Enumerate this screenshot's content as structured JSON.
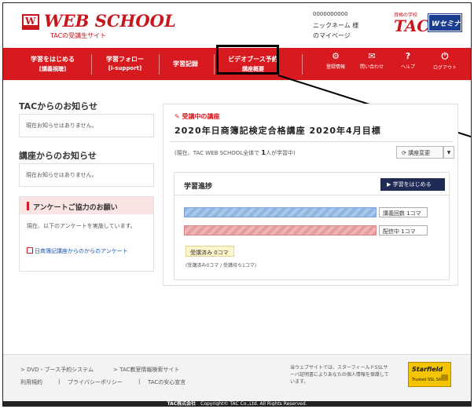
{
  "header": {
    "logo": "WEB SCHOOL",
    "logo_sub": "TACの受講生サイト",
    "user_id": "0000000000",
    "user_name": "ニックネーム 様",
    "my_page": "のマイページ",
    "brand_small": "資格の学校",
    "brand": "TAC",
    "partner": "Wセミナー"
  },
  "nav": {
    "items": [
      {
        "line1": "学習をはじめる",
        "line2": "[講義視聴]"
      },
      {
        "line1": "学習フォロー",
        "line2": "[i-support]"
      },
      {
        "line1": "学習記録",
        "line2": ""
      },
      {
        "line1": "ビデオブース予約",
        "line2": "講座概要"
      }
    ],
    "icons": [
      {
        "glyph": "⚙",
        "label": "登録情報"
      },
      {
        "glyph": "✉",
        "label": "問い合わせ"
      },
      {
        "glyph": "?",
        "label": "ヘルプ"
      },
      {
        "glyph": "⏻",
        "label": "ログアウト"
      }
    ]
  },
  "left": {
    "tac_notice_title": "TACからのお知らせ",
    "tac_notice_text": "現在お知らせはありません。",
    "course_notice_title": "講座からのお知らせ",
    "course_notice_text": "現在お知らせはありません。",
    "survey_title": "アンケートご協力のお願い",
    "survey_text": "現在、以下のアンケートを実施しています。",
    "survey_link": "日商簿記講座からのからのアンケート"
  },
  "course": {
    "label": "受講中の講座",
    "title": "2020年日商簿記検定合格講座 2020年4月目標",
    "note_prefix": "(現在、TAC WEB SCHOOL全体で",
    "note_count": "1",
    "note_suffix": "人が学習中)",
    "change_button": "講座変更",
    "progress_title": "学習進捗",
    "start_button": "▶ 学習をはじめる",
    "bar1_label": "講義回数 1コマ",
    "bar2_label": "配信中 1コマ",
    "done_label": "受講済み 0コマ",
    "done_sub": "(受講済み0コマ / 受講待ち1コマ)"
  },
  "progress": {
    "lecture_count": 1,
    "distributing": 1,
    "done": 0
  },
  "footer": {
    "link1": "> DVD・ブース予約システム",
    "link2": "> TAC教室情報検索サイト",
    "links2": [
      "利用規約",
      "プライバシーポリシー",
      "TACの安心宣言"
    ],
    "ssl_text": "当ウェブサイトでは、スターフィールドSSLサーバ証明書によりあなたの個人情報を保護しています。",
    "ssl_brand": "Starfield",
    "ssl_sub": "Trusted SSL Site",
    "company": "TAC株式会社",
    "copyright": "Copyright© TAC Co.,Ltd. All Rights Reserved."
  },
  "colors": {
    "brand_red": "#d71a1f",
    "navy": "#1f2a55"
  }
}
